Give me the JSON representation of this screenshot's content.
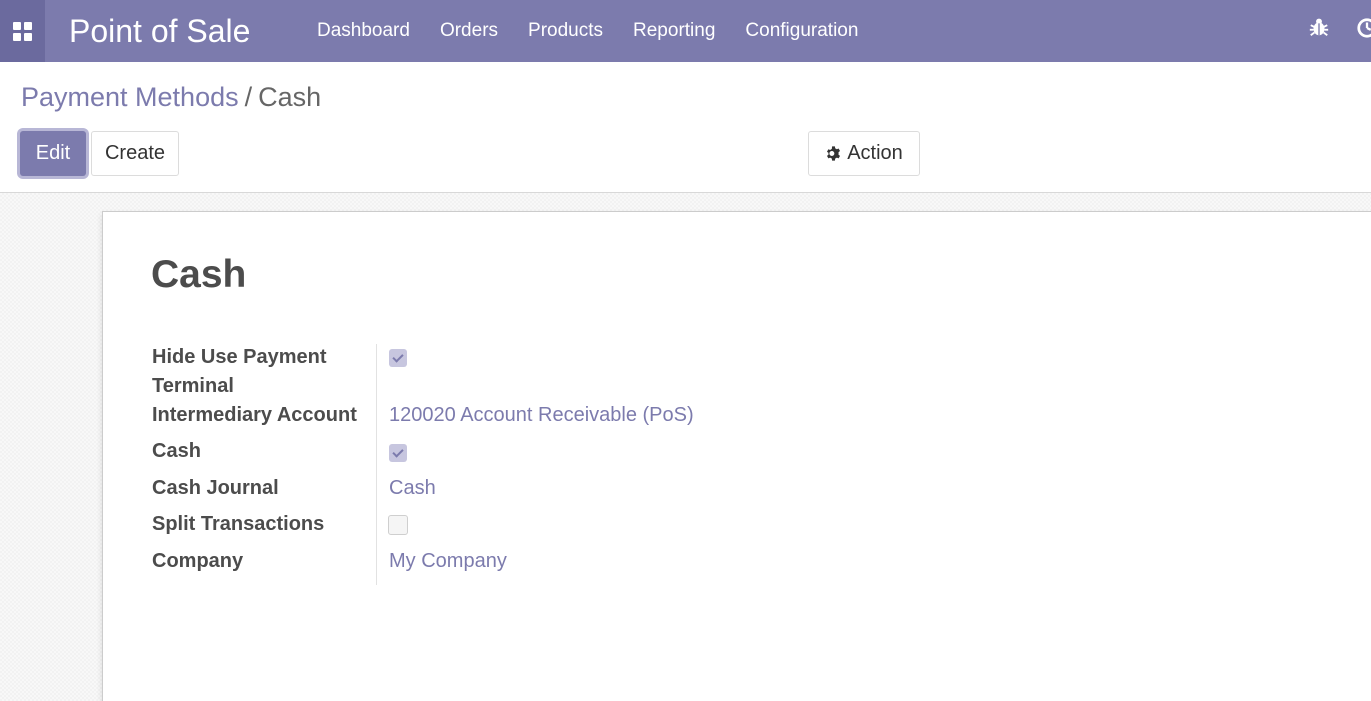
{
  "navbar": {
    "app_title": "Point of Sale",
    "menu": [
      "Dashboard",
      "Orders",
      "Products",
      "Reporting",
      "Configuration"
    ],
    "icons": [
      "apps-grid-icon",
      "bug-icon",
      "clock-icon"
    ],
    "color": "#7c7bad"
  },
  "breadcrumb": {
    "parent": "Payment Methods",
    "separator": "/",
    "current": "Cash"
  },
  "buttons": {
    "edit": "Edit",
    "create": "Create",
    "action": "Action"
  },
  "record": {
    "title": "Cash",
    "fields": {
      "hide_use_payment_terminal": {
        "label_line1": "Hide Use Payment",
        "label_line2": "Terminal",
        "checked": true
      },
      "intermediary_account": {
        "label": "Intermediary Account",
        "value": "120020 Account Receivable (PoS)"
      },
      "cash": {
        "label": "Cash",
        "checked": true
      },
      "cash_journal": {
        "label": "Cash Journal",
        "value": "Cash"
      },
      "split_transactions": {
        "label": "Split Transactions",
        "checked": false
      },
      "company": {
        "label": "Company",
        "value": "My Company"
      }
    }
  }
}
